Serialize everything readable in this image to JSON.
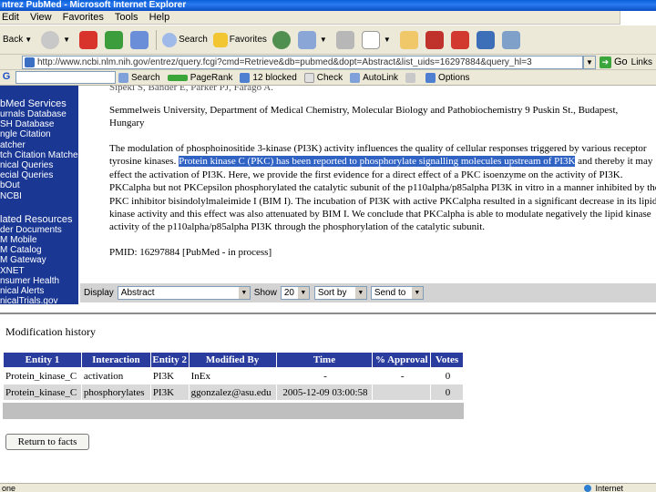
{
  "window": {
    "title": "ntrez PubMed - Microsoft Internet Explorer"
  },
  "menu": [
    "Edit",
    "View",
    "Favorites",
    "Tools",
    "Help"
  ],
  "toolbar": {
    "back_label": "Back",
    "search_label": "Search",
    "favorites_label": "Favorites"
  },
  "address": {
    "url": "http://www.ncbi.nlm.nih.gov/entrez/query.fcgi?cmd=Retrieve&db=pubmed&dopt=Abstract&list_uids=16297884&query_hl=3",
    "go_label": "Go",
    "links_label": "Links"
  },
  "google_toolbar": {
    "search_label": "Search",
    "pagerank_label": "PageRank",
    "blocked_label": "12 blocked",
    "check_label": "Check",
    "autolink_label": "AutoLink",
    "options_label": "Options"
  },
  "sidebar": {
    "heading1": "bMed Services",
    "items1": [
      "urnals Database",
      "SH Database",
      "ngle Citation",
      "atcher",
      "tch Citation Matcher",
      "nical Queries",
      "ecial Queries",
      "bOut",
      "NCBI"
    ],
    "heading2": "lated Resources",
    "items2": [
      "der Documents",
      "M Mobile",
      "M Catalog",
      "M Gateway",
      "XNET",
      "nsumer Health",
      "nical Alerts",
      "nicalTrials.gov"
    ]
  },
  "article": {
    "authors": "Sipeki S, Bander E, Parker PJ, Farago A.",
    "affiliation": "Semmelweis University, Department of Medical Chemistry, Molecular Biology and Pathobiochemistry 9 Puskin St., Budapest, Hungary",
    "abstract_before": "The modulation of phosphoinositide 3-kinase (PI3K) activity influences the quality of cellular responses triggered by various receptor tyrosine kinases. ",
    "abstract_highlight": "Protein kinase C (PKC) has been reported to phosphorylate signalling molecules upstream of PI3K",
    "abstract_after": " and thereby it may effect the activation of PI3K. Here, we provide the first evidence for a direct effect of a PKC isoenzyme on the activity of PI3K. PKCalpha but not PKCepsilon phosphorylated the catalytic subunit of the p110alpha/p85alpha PI3K in vitro in a manner inhibited by the PKC inhibitor bisindolylmaleimide I (BIM I). The incubation of PI3K with active PKCalpha resulted in a significant decrease in its lipid kinase activity and this effect was also attenuated by BIM I. We conclude that PKCalpha is able to modulate negatively the lipid kinase activity of the p110alpha/p85alpha PI3K through the phosphorylation of the catalytic subunit.",
    "pmid": "PMID: 16297884 [PubMed - in process]"
  },
  "display_bar": {
    "display_label": "Display",
    "display_value": "Abstract",
    "show_label": "Show",
    "show_value": "20",
    "sort_value": "Sort by",
    "send_value": "Send to"
  },
  "modification": {
    "title": "Modification history",
    "columns": [
      "Entity 1",
      "Interaction",
      "Entity 2",
      "Modified By",
      "Time",
      "% Approval",
      "Votes"
    ],
    "rows": [
      [
        "Protein_kinase_C",
        "activation",
        "PI3K",
        "InEx",
        "-",
        "-",
        "0"
      ],
      [
        "Protein_kinase_C",
        "phosphorylates",
        "PI3K",
        "ggonzalez@asu.edu",
        "2005-12-09 03:00:58",
        "",
        "0"
      ]
    ],
    "return_label": "Return to facts"
  },
  "status": {
    "left": "one",
    "zone": "Internet"
  }
}
